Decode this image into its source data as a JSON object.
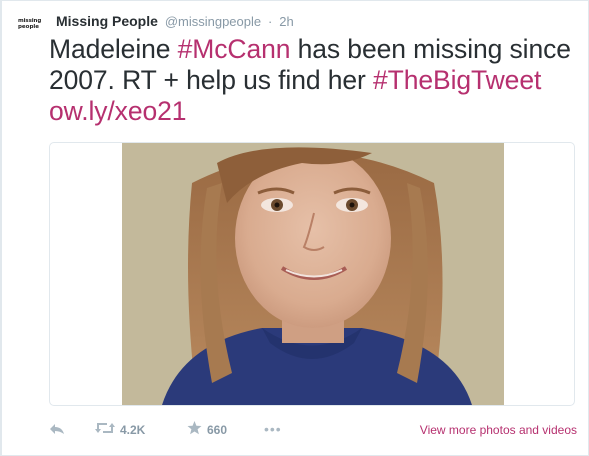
{
  "account": {
    "avatar_line1": "missing",
    "avatar_line2": "people",
    "display_name": "Missing People",
    "username": "@missingpeople",
    "separator": "·",
    "time": "2h"
  },
  "tweet": {
    "text_part1": "Madeleine ",
    "hashtag1": "#McCann",
    "text_part2": " has been missing since 2007. RT + help us find her ",
    "hashtag2": "#TheBigTweet",
    "link": "ow.ly/xeo21"
  },
  "colors": {
    "link": "#b6306f",
    "meta": "#8899a6",
    "border": "#e1e8ed"
  },
  "actions": {
    "reply_icon": "reply-icon",
    "retweet_icon": "retweet-icon",
    "retweet_count": "4.2K",
    "favorite_icon": "star-icon",
    "favorite_count": "660",
    "more_icon": "more-dots-icon",
    "more_label": "•••",
    "view_more": "View more photos and videos"
  }
}
